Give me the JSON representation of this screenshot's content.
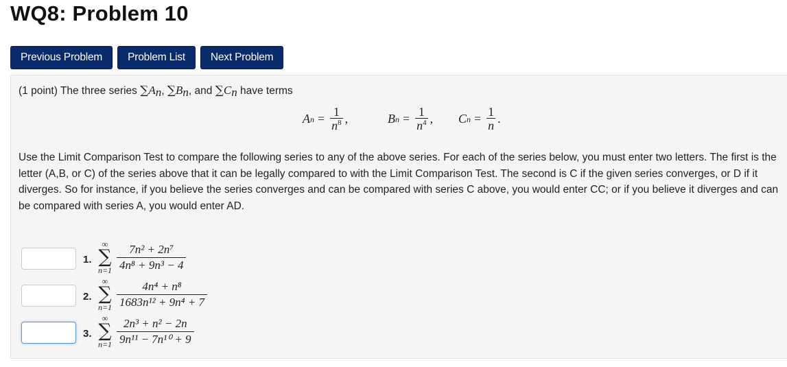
{
  "page": {
    "title": "WQ8: Problem 10"
  },
  "nav": {
    "previous_label": "Previous Problem",
    "list_label": "Problem List",
    "next_label": "Next Problem"
  },
  "problem": {
    "points": "(1 point)",
    "intro_pre": "The three series",
    "intro_and": "and",
    "intro_post": "have terms",
    "series_names": [
      "A",
      "B",
      "C"
    ],
    "index_var": "n",
    "terms": [
      {
        "name": "A",
        "numerator": "1",
        "denominator": "n",
        "exponent": "8"
      },
      {
        "name": "B",
        "numerator": "1",
        "denominator": "n",
        "exponent": "4"
      },
      {
        "name": "C",
        "numerator": "1",
        "denominator": "n",
        "exponent": ""
      }
    ],
    "description": "Use the Limit Comparison Test to compare the following series to any of the above series. For each of the series below, you must enter two letters. The first is the letter (A,B, or C) of the series above that it can be legally compared to with the Limit Comparison Test. The second is C if the given series converges, or D if it diverges. So for instance, if you believe the series converges and can be compared with series C above, you would enter CC; or if you believe it diverges and can be compared with series A, you would enter AD."
  },
  "answers": [
    {
      "number": "1.",
      "value": "",
      "sum_upper": "∞",
      "sum_lower": "n=1",
      "numerator": "7n² + 2n⁷",
      "denominator": "4n⁸ + 9n³ − 4"
    },
    {
      "number": "2.",
      "value": "",
      "sum_upper": "∞",
      "sum_lower": "n=1",
      "numerator": "4n⁴ + n⁸",
      "denominator": "1683n¹² + 9n⁴ + 7"
    },
    {
      "number": "3.",
      "value": "",
      "sum_upper": "∞",
      "sum_lower": "n=1",
      "numerator": "2n³ + n² − 2n",
      "denominator": "9n¹¹ − 7n¹⁰ + 9"
    }
  ]
}
